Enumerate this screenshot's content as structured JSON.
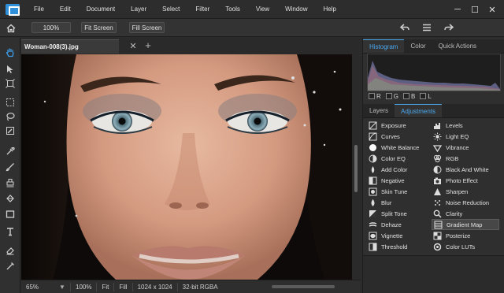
{
  "menu": {
    "items": [
      "File",
      "Edit",
      "Document",
      "Layer",
      "Select",
      "Filter",
      "Tools",
      "View",
      "Window",
      "Help"
    ]
  },
  "window_controls": {
    "minimize": "─",
    "maximize": "☐",
    "close": "✕"
  },
  "options_bar": {
    "zoom_value": "100%",
    "fit_screen": "Fit Screen",
    "fill_screen": "Fill Screen"
  },
  "document": {
    "tab_title": "Woman-008(3).jpg",
    "close_glyph": "✕",
    "add_glyph": "+"
  },
  "status": {
    "zoom": "65%",
    "zoom_arrow": "▼",
    "zoom_100": "100%",
    "fit": "Fit",
    "fill": "Fill",
    "dimensions": "1024 x 1024",
    "mode": "32-bit RGBA"
  },
  "top_panel": {
    "tabs": [
      "Histogram",
      "Color",
      "Quick Actions"
    ],
    "active_tab": "Histogram",
    "channels": [
      "R",
      "G",
      "B",
      "L"
    ]
  },
  "bottom_panel": {
    "tabs": [
      "Layers",
      "Adjustments"
    ],
    "active_tab": "Adjustments",
    "adjustments_left": [
      {
        "label": "Exposure",
        "icon": "exposure-icon"
      },
      {
        "label": "Curves",
        "icon": "curves-icon"
      },
      {
        "label": "White Balance",
        "icon": "white-balance-icon"
      },
      {
        "label": "Color EQ",
        "icon": "color-eq-icon"
      },
      {
        "label": "Add Color",
        "icon": "add-color-icon"
      },
      {
        "label": "Negative",
        "icon": "negative-icon"
      },
      {
        "label": "Skin Tune",
        "icon": "skin-tune-icon"
      },
      {
        "label": "Blur",
        "icon": "blur-icon"
      },
      {
        "label": "Split Tone",
        "icon": "split-tone-icon"
      },
      {
        "label": "Dehaze",
        "icon": "dehaze-icon"
      },
      {
        "label": "Vignette",
        "icon": "vignette-icon"
      },
      {
        "label": "Threshold",
        "icon": "threshold-icon"
      }
    ],
    "adjustments_right": [
      {
        "label": "Levels",
        "icon": "levels-icon"
      },
      {
        "label": "Light EQ",
        "icon": "light-eq-icon"
      },
      {
        "label": "Vibrance",
        "icon": "vibrance-icon"
      },
      {
        "label": "RGB",
        "icon": "rgb-icon"
      },
      {
        "label": "Black And White",
        "icon": "black-and-white-icon"
      },
      {
        "label": "Photo Effect",
        "icon": "photo-effect-icon"
      },
      {
        "label": "Sharpen",
        "icon": "sharpen-icon"
      },
      {
        "label": "Noise Reduction",
        "icon": "noise-reduction-icon"
      },
      {
        "label": "Clarity",
        "icon": "clarity-icon"
      },
      {
        "label": "Gradient Map",
        "icon": "gradient-map-icon",
        "selected": true
      },
      {
        "label": "Posterize",
        "icon": "posterize-icon"
      },
      {
        "label": "Color LUTs",
        "icon": "color-luts-icon"
      }
    ]
  },
  "colors": {
    "accent": "#4aa8ef",
    "panel_bg": "#2f2f2f",
    "menubar_bg": "#2d2d2d",
    "selected_row": "#474747"
  }
}
